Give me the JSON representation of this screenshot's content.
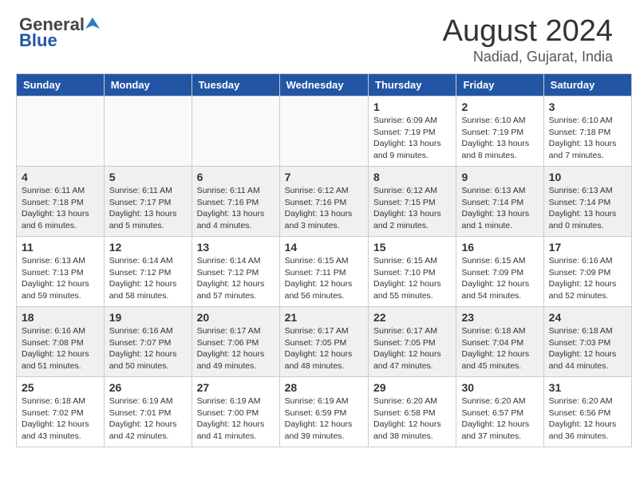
{
  "header": {
    "logo_general": "General",
    "logo_blue": "Blue",
    "month_year": "August 2024",
    "location": "Nadiad, Gujarat, India"
  },
  "days_of_week": [
    "Sunday",
    "Monday",
    "Tuesday",
    "Wednesday",
    "Thursday",
    "Friday",
    "Saturday"
  ],
  "weeks": [
    [
      {
        "day": "",
        "info": "",
        "empty": true
      },
      {
        "day": "",
        "info": "",
        "empty": true
      },
      {
        "day": "",
        "info": "",
        "empty": true
      },
      {
        "day": "",
        "info": "",
        "empty": true
      },
      {
        "day": "1",
        "info": "Sunrise: 6:09 AM\nSunset: 7:19 PM\nDaylight: 13 hours\nand 9 minutes."
      },
      {
        "day": "2",
        "info": "Sunrise: 6:10 AM\nSunset: 7:19 PM\nDaylight: 13 hours\nand 8 minutes."
      },
      {
        "day": "3",
        "info": "Sunrise: 6:10 AM\nSunset: 7:18 PM\nDaylight: 13 hours\nand 7 minutes."
      }
    ],
    [
      {
        "day": "4",
        "info": "Sunrise: 6:11 AM\nSunset: 7:18 PM\nDaylight: 13 hours\nand 6 minutes."
      },
      {
        "day": "5",
        "info": "Sunrise: 6:11 AM\nSunset: 7:17 PM\nDaylight: 13 hours\nand 5 minutes."
      },
      {
        "day": "6",
        "info": "Sunrise: 6:11 AM\nSunset: 7:16 PM\nDaylight: 13 hours\nand 4 minutes."
      },
      {
        "day": "7",
        "info": "Sunrise: 6:12 AM\nSunset: 7:16 PM\nDaylight: 13 hours\nand 3 minutes."
      },
      {
        "day": "8",
        "info": "Sunrise: 6:12 AM\nSunset: 7:15 PM\nDaylight: 13 hours\nand 2 minutes."
      },
      {
        "day": "9",
        "info": "Sunrise: 6:13 AM\nSunset: 7:14 PM\nDaylight: 13 hours\nand 1 minute."
      },
      {
        "day": "10",
        "info": "Sunrise: 6:13 AM\nSunset: 7:14 PM\nDaylight: 13 hours\nand 0 minutes."
      }
    ],
    [
      {
        "day": "11",
        "info": "Sunrise: 6:13 AM\nSunset: 7:13 PM\nDaylight: 12 hours\nand 59 minutes."
      },
      {
        "day": "12",
        "info": "Sunrise: 6:14 AM\nSunset: 7:12 PM\nDaylight: 12 hours\nand 58 minutes."
      },
      {
        "day": "13",
        "info": "Sunrise: 6:14 AM\nSunset: 7:12 PM\nDaylight: 12 hours\nand 57 minutes."
      },
      {
        "day": "14",
        "info": "Sunrise: 6:15 AM\nSunset: 7:11 PM\nDaylight: 12 hours\nand 56 minutes."
      },
      {
        "day": "15",
        "info": "Sunrise: 6:15 AM\nSunset: 7:10 PM\nDaylight: 12 hours\nand 55 minutes."
      },
      {
        "day": "16",
        "info": "Sunrise: 6:15 AM\nSunset: 7:09 PM\nDaylight: 12 hours\nand 54 minutes."
      },
      {
        "day": "17",
        "info": "Sunrise: 6:16 AM\nSunset: 7:09 PM\nDaylight: 12 hours\nand 52 minutes."
      }
    ],
    [
      {
        "day": "18",
        "info": "Sunrise: 6:16 AM\nSunset: 7:08 PM\nDaylight: 12 hours\nand 51 minutes."
      },
      {
        "day": "19",
        "info": "Sunrise: 6:16 AM\nSunset: 7:07 PM\nDaylight: 12 hours\nand 50 minutes."
      },
      {
        "day": "20",
        "info": "Sunrise: 6:17 AM\nSunset: 7:06 PM\nDaylight: 12 hours\nand 49 minutes."
      },
      {
        "day": "21",
        "info": "Sunrise: 6:17 AM\nSunset: 7:05 PM\nDaylight: 12 hours\nand 48 minutes."
      },
      {
        "day": "22",
        "info": "Sunrise: 6:17 AM\nSunset: 7:05 PM\nDaylight: 12 hours\nand 47 minutes."
      },
      {
        "day": "23",
        "info": "Sunrise: 6:18 AM\nSunset: 7:04 PM\nDaylight: 12 hours\nand 45 minutes."
      },
      {
        "day": "24",
        "info": "Sunrise: 6:18 AM\nSunset: 7:03 PM\nDaylight: 12 hours\nand 44 minutes."
      }
    ],
    [
      {
        "day": "25",
        "info": "Sunrise: 6:18 AM\nSunset: 7:02 PM\nDaylight: 12 hours\nand 43 minutes."
      },
      {
        "day": "26",
        "info": "Sunrise: 6:19 AM\nSunset: 7:01 PM\nDaylight: 12 hours\nand 42 minutes."
      },
      {
        "day": "27",
        "info": "Sunrise: 6:19 AM\nSunset: 7:00 PM\nDaylight: 12 hours\nand 41 minutes."
      },
      {
        "day": "28",
        "info": "Sunrise: 6:19 AM\nSunset: 6:59 PM\nDaylight: 12 hours\nand 39 minutes."
      },
      {
        "day": "29",
        "info": "Sunrise: 6:20 AM\nSunset: 6:58 PM\nDaylight: 12 hours\nand 38 minutes."
      },
      {
        "day": "30",
        "info": "Sunrise: 6:20 AM\nSunset: 6:57 PM\nDaylight: 12 hours\nand 37 minutes."
      },
      {
        "day": "31",
        "info": "Sunrise: 6:20 AM\nSunset: 6:56 PM\nDaylight: 12 hours\nand 36 minutes."
      }
    ]
  ]
}
